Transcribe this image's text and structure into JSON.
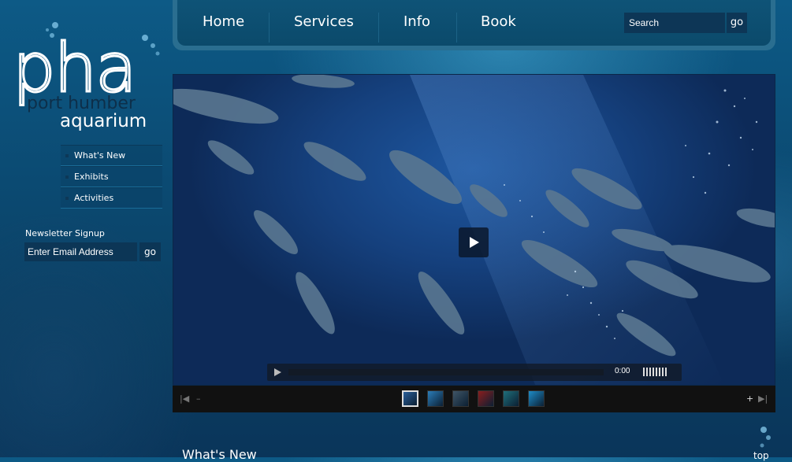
{
  "logo": {
    "wordmark": "pha",
    "line1": "port humber",
    "line2": "aquarium"
  },
  "topnav": {
    "items": [
      "Home",
      "Services",
      "Info",
      "Book"
    ],
    "search_placeholder": "Search",
    "search_go": "go"
  },
  "sidebar": {
    "items": [
      {
        "label": "What's New"
      },
      {
        "label": "Exhibits"
      },
      {
        "label": "Activities"
      }
    ]
  },
  "newsletter": {
    "label": "Newsletter Signup",
    "placeholder": "Enter Email Address",
    "go": "go"
  },
  "video": {
    "time": "0:00",
    "thumbnail_colors": [
      "#2a5f9a",
      "#2b7db8",
      "#3f5566",
      "#8a1d1d",
      "#1f6f7a",
      "#1e8cc8"
    ],
    "selected_thumbnail": 0
  },
  "main": {
    "section_title": "What's New",
    "top_link": "top"
  },
  "colors": {
    "accent_dark": "#0c3656",
    "nav_bar": "#0f5478",
    "video_water": "#15407d"
  }
}
